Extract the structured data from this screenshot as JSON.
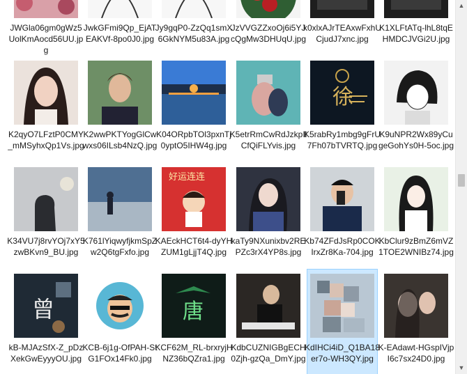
{
  "files": [
    [
      "JWGla06gm0gWz5UolKmAocd56UU.jpg",
      "JwkGFmi9Qp_EjATEAKVf-8po0J0.jpg",
      "Jy9gqP0-ZzQq1smX6GkNYM5u83A.jpg",
      "JzVVGZZxoOj6i5YJcQgMw3DHUqU.jpg",
      "k0xlxAJrTEAxwFxhUCjudJ7xnc.jpg",
      "K1XLFtATq-lhL8tqEHMDCJVGi2U.jpg"
    ],
    [
      "K2qyO7LFztP0CMY_mMSyhxQp1Vs.jpg",
      "K2wwPKTYogGlCwwxs06ILsb4NzQ.jpg",
      "K04ORpbTOl3pxnTj0yptO5IHW4g.jpg",
      "K5etrRmCwRdJzkpIlCfQiFLYvis.jpg",
      "K5rabRy1mbg9gFrU7Fh07bTVRTQ.jpg",
      "K9uNPR2Wx89yCugeGohYs0H-5oc.jpg"
    ],
    [
      "K34VU7j8rvYOj7xY5zwBKvn9_BU.jpg",
      "K761lYiqwyfjkmSpZw2Q6tgFxfo.jpg",
      "KAEckHCT6t4-dyYHZUM1gLjjT4Q.jpg",
      "kaTy9NXunixbv2REPZc3rX4YP8s.jpg",
      "Kb74ZFdJsRp0COKIrxZr8Ka-704.jpg",
      "KbClur9zBmZ6mVZ1TOE2WNIBz74.jpg"
    ],
    [
      "kB-MJAzSfX-Z_pDzXekGwEyyyOU.jpg",
      "KCB-6j1g-OfPAH-StG1FOx14Fk0.jpg",
      "KCF62M_RL-brxryjHNZ36bQZra1.jpg",
      "KdbCUZNIGBgECH0Zjh-gzQa_DmY.jpg",
      "KdIHCi4iD_Q1BA18er7o-WH3QY.jpg",
      "K-EAdawt-HGspIVjpI6c7sx24D0.jpg"
    ]
  ],
  "thumbnails": [
    [
      "portrait-flowers",
      "line-art-portrait",
      "line-art-portrait",
      "red-flowers",
      "dark-tile",
      "dark-tile"
    ],
    [
      "woman-portrait",
      "man-portrait",
      "lake-sunset",
      "couple-water",
      "dark-calligraphy",
      "anime-boy"
    ],
    [
      "silhouette-sky",
      "beach-person",
      "cartoon-red",
      "woman-dark",
      "man-phone",
      "anime-girl"
    ],
    [
      "snail-calligraphy",
      "cartoon-mustache",
      "bird-calligraphy",
      "piano-dark",
      "blurred-face",
      "couple-portrait"
    ]
  ],
  "thumbnail_texts": {
    "cartoon-red": "好运连连",
    "snail-calligraphy": "曾",
    "bird-calligraphy": "唐",
    "dark-calligraphy": "徐"
  },
  "selected_file": "KdIHCi4iD_Q1BA18er7o-WH3QY.jpg",
  "scrollbar": {
    "up_icon": "▲",
    "down_icon": "▼",
    "position_fraction": 0.48
  }
}
